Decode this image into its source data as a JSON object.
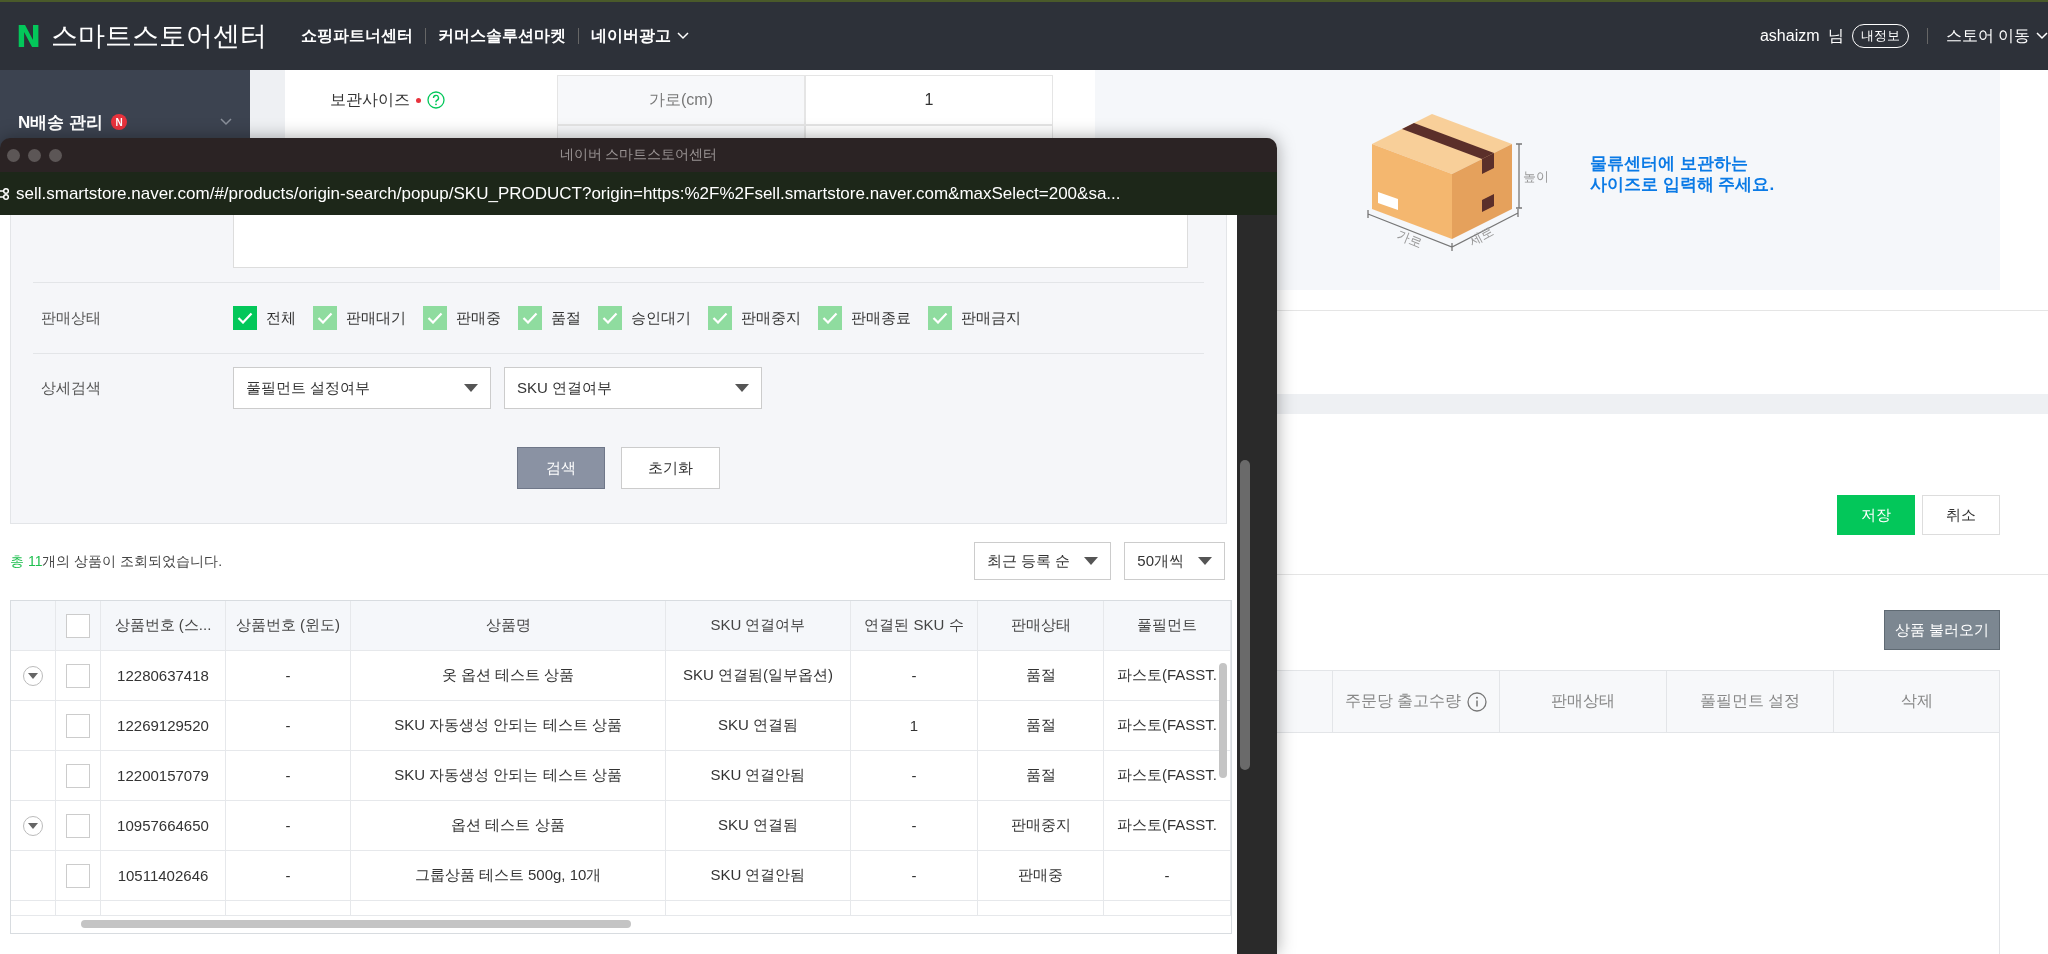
{
  "top_nav": {
    "logo": "N",
    "brand": "스마트스토어센터",
    "links": [
      {
        "label": "쇼핑파트너센터",
        "dropdown": false
      },
      {
        "label": "커머스솔루션마켓",
        "dropdown": false
      },
      {
        "label": "네이버광고",
        "dropdown": true
      }
    ],
    "user_name": "ashaizm",
    "user_suffix": "님",
    "profile_button": "내정보",
    "store_menu": "스토어 이동"
  },
  "sidebar": {
    "items": [
      {
        "label": "N배송 관리",
        "badge": "N",
        "expanded": false
      }
    ]
  },
  "storage_size": {
    "label": "보관사이즈",
    "required": true,
    "cells": [
      "가로(cm)",
      "1"
    ]
  },
  "size_guide": {
    "height_label": "높이",
    "width_label": "가로",
    "depth_label": "세로",
    "message": [
      "물류센터에 보관하는",
      "사이즈로 입력해 주세요."
    ]
  },
  "form_buttons": [
    {
      "label": "저장",
      "kind": "primary"
    },
    {
      "label": "취소",
      "kind": "secondary"
    }
  ],
  "product_section": {
    "load_button": "상품 불러오기",
    "columns": [
      {
        "label": "주문당 출고수량",
        "info": true
      },
      {
        "label": "판매상태",
        "info": false
      },
      {
        "label": "풀필먼트 설정",
        "info": false
      },
      {
        "label": "삭제",
        "info": false
      }
    ]
  },
  "popup": {
    "title": "네이버 스마트스토어센터",
    "url": "sell.smartstore.naver.com/#/products/origin-search/popup/SKU_PRODUCT?origin=https:%2F%2Fsell.smartstore.naver.com&maxSelect=200&sa...",
    "sale_status": {
      "label": "판매상태",
      "options": [
        {
          "label": "전체",
          "checked": true,
          "disabled": false
        },
        {
          "label": "판매대기",
          "checked": true,
          "disabled": true
        },
        {
          "label": "판매중",
          "checked": true,
          "disabled": true
        },
        {
          "label": "품절",
          "checked": true,
          "disabled": true
        },
        {
          "label": "승인대기",
          "checked": true,
          "disabled": true
        },
        {
          "label": "판매중지",
          "checked": true,
          "disabled": true
        },
        {
          "label": "판매종료",
          "checked": true,
          "disabled": true
        },
        {
          "label": "판매금지",
          "checked": true,
          "disabled": true
        }
      ]
    },
    "detail_search": {
      "label": "상세검색",
      "selects": [
        {
          "value": "풀필먼트 설정여부"
        },
        {
          "value": "SKU 연결여부"
        }
      ]
    },
    "buttons": [
      {
        "label": "검색",
        "kind": "primary"
      },
      {
        "label": "초기화",
        "kind": "secondary"
      }
    ],
    "result_summary": "**총 11**개의 상품이 조회되었습니다.",
    "sort_selects": [
      {
        "value": "최근 등록 순"
      },
      {
        "value": "50개씩"
      }
    ],
    "table": {
      "header_checked": false,
      "columns": [
        "상품번호 (스...",
        "상품번호 (윈도)",
        "상품명",
        "SKU 연결여부",
        "연결된 SKU 수",
        "판매상태",
        "풀필먼트"
      ],
      "rows": [
        {
          "expandable": true,
          "checked": false,
          "cells": [
            "12280637418",
            "-",
            "옷 옵션 테스트 상품",
            "SKU 연결됨(일부옵션)",
            "-",
            "품절",
            "파스토(FASST."
          ]
        },
        {
          "expandable": false,
          "checked": false,
          "cells": [
            "12269129520",
            "-",
            "SKU 자동생성 안되는 테스트 상품",
            "SKU 연결됨",
            "1",
            "품절",
            "파스토(FASST."
          ]
        },
        {
          "expandable": false,
          "checked": false,
          "cells": [
            "12200157079",
            "-",
            "SKU 자동생성 안되는 테스트 상품",
            "SKU 연결안됨",
            "-",
            "품절",
            "파스토(FASST."
          ]
        },
        {
          "expandable": true,
          "checked": false,
          "cells": [
            "10957664650",
            "-",
            "옵션 테스트 상품",
            "SKU 연결됨",
            "-",
            "판매중지",
            "파스토(FASST."
          ]
        },
        {
          "expandable": false,
          "checked": false,
          "cells": [
            "10511402646",
            "-",
            "그룹상품 테스트 500g, 10개",
            "SKU 연결안됨",
            "-",
            "판매중",
            "-"
          ]
        }
      ]
    }
  }
}
